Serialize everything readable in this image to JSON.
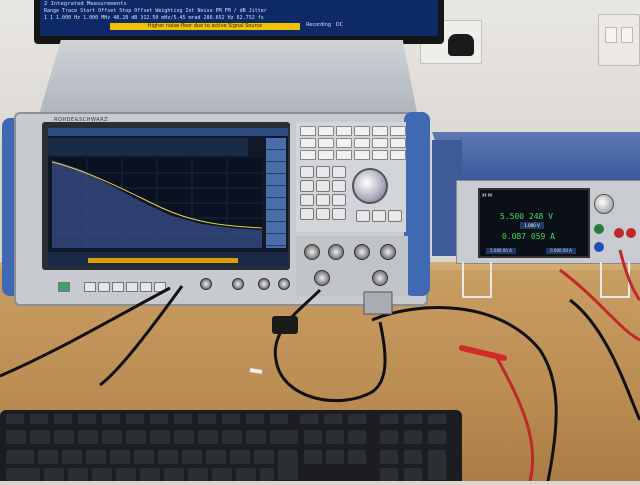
{
  "photo": {
    "monitor": {
      "rows": [
        "2 Integrated Measurements",
        "Range  Trace  Start Offset   Stop Offset   Weighting   Int Noise   PM   FM / dB   Jitter",
        "  1      1     1.000 Hz       1.000 MHz                 48.28 dB   312.50 mHz/5.45 mrad   286.652 Hz   62.752 fs"
      ],
      "status_bar": "Higher noise floor due to active Signal Source",
      "buttons": [
        "Recording",
        "DC"
      ]
    },
    "analyzer": {
      "brand": "ROHDE&SCHWARZ"
    },
    "power_supply": {
      "voltage_set": "5.500 248 V",
      "current_read": "0.087 059 A",
      "mid_button": "1.000 V",
      "bottom_left": "5.000 00 A",
      "bottom_right": "0.000 00 A"
    },
    "colors": {
      "analyzer_blue": "#3f6ab3",
      "psu_blue": "#3c589a",
      "desk": "#c99e63",
      "psu_readout_green": "#3ddc5a"
    }
  }
}
